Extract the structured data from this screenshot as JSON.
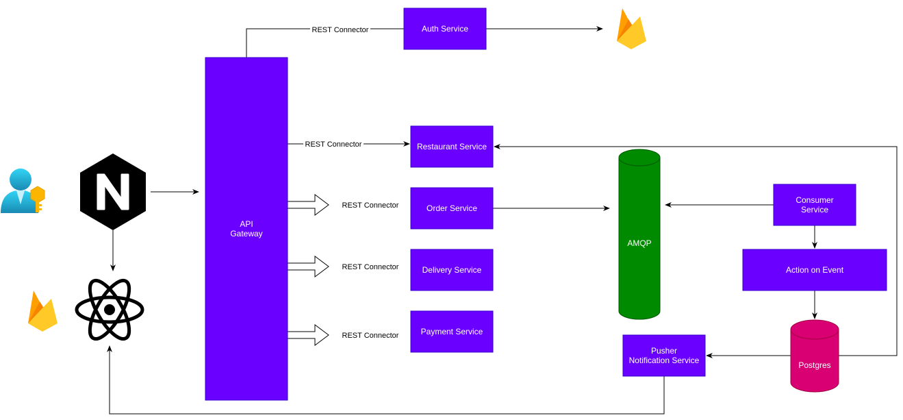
{
  "colors": {
    "service": "#6a00ff",
    "queue": "#008a00",
    "database": "#d80073"
  },
  "nodes": {
    "auth": "Auth Service",
    "gateway_line1": "API",
    "gateway_line2": "Gateway",
    "restaurant": "Restaurant Service",
    "order": "Order Service",
    "delivery": "Delivery Service",
    "payment": "Payment Service",
    "amqp": "AMQP",
    "consumer_line1": "Consumer",
    "consumer_line2": "Service",
    "action": "Action on Event",
    "postgres": "Postgres",
    "pusher_line1": "Pusher",
    "pusher_line2": "Notification Service"
  },
  "edges": {
    "auth_label": "REST Connector",
    "restaurant_label": "REST Connector",
    "order_label": "REST Connector",
    "delivery_label": "REST Connector",
    "payment_label": "REST Connector"
  },
  "icons": [
    "user-key-icon",
    "nginx-icon",
    "react-icon",
    "firebase-icon"
  ]
}
